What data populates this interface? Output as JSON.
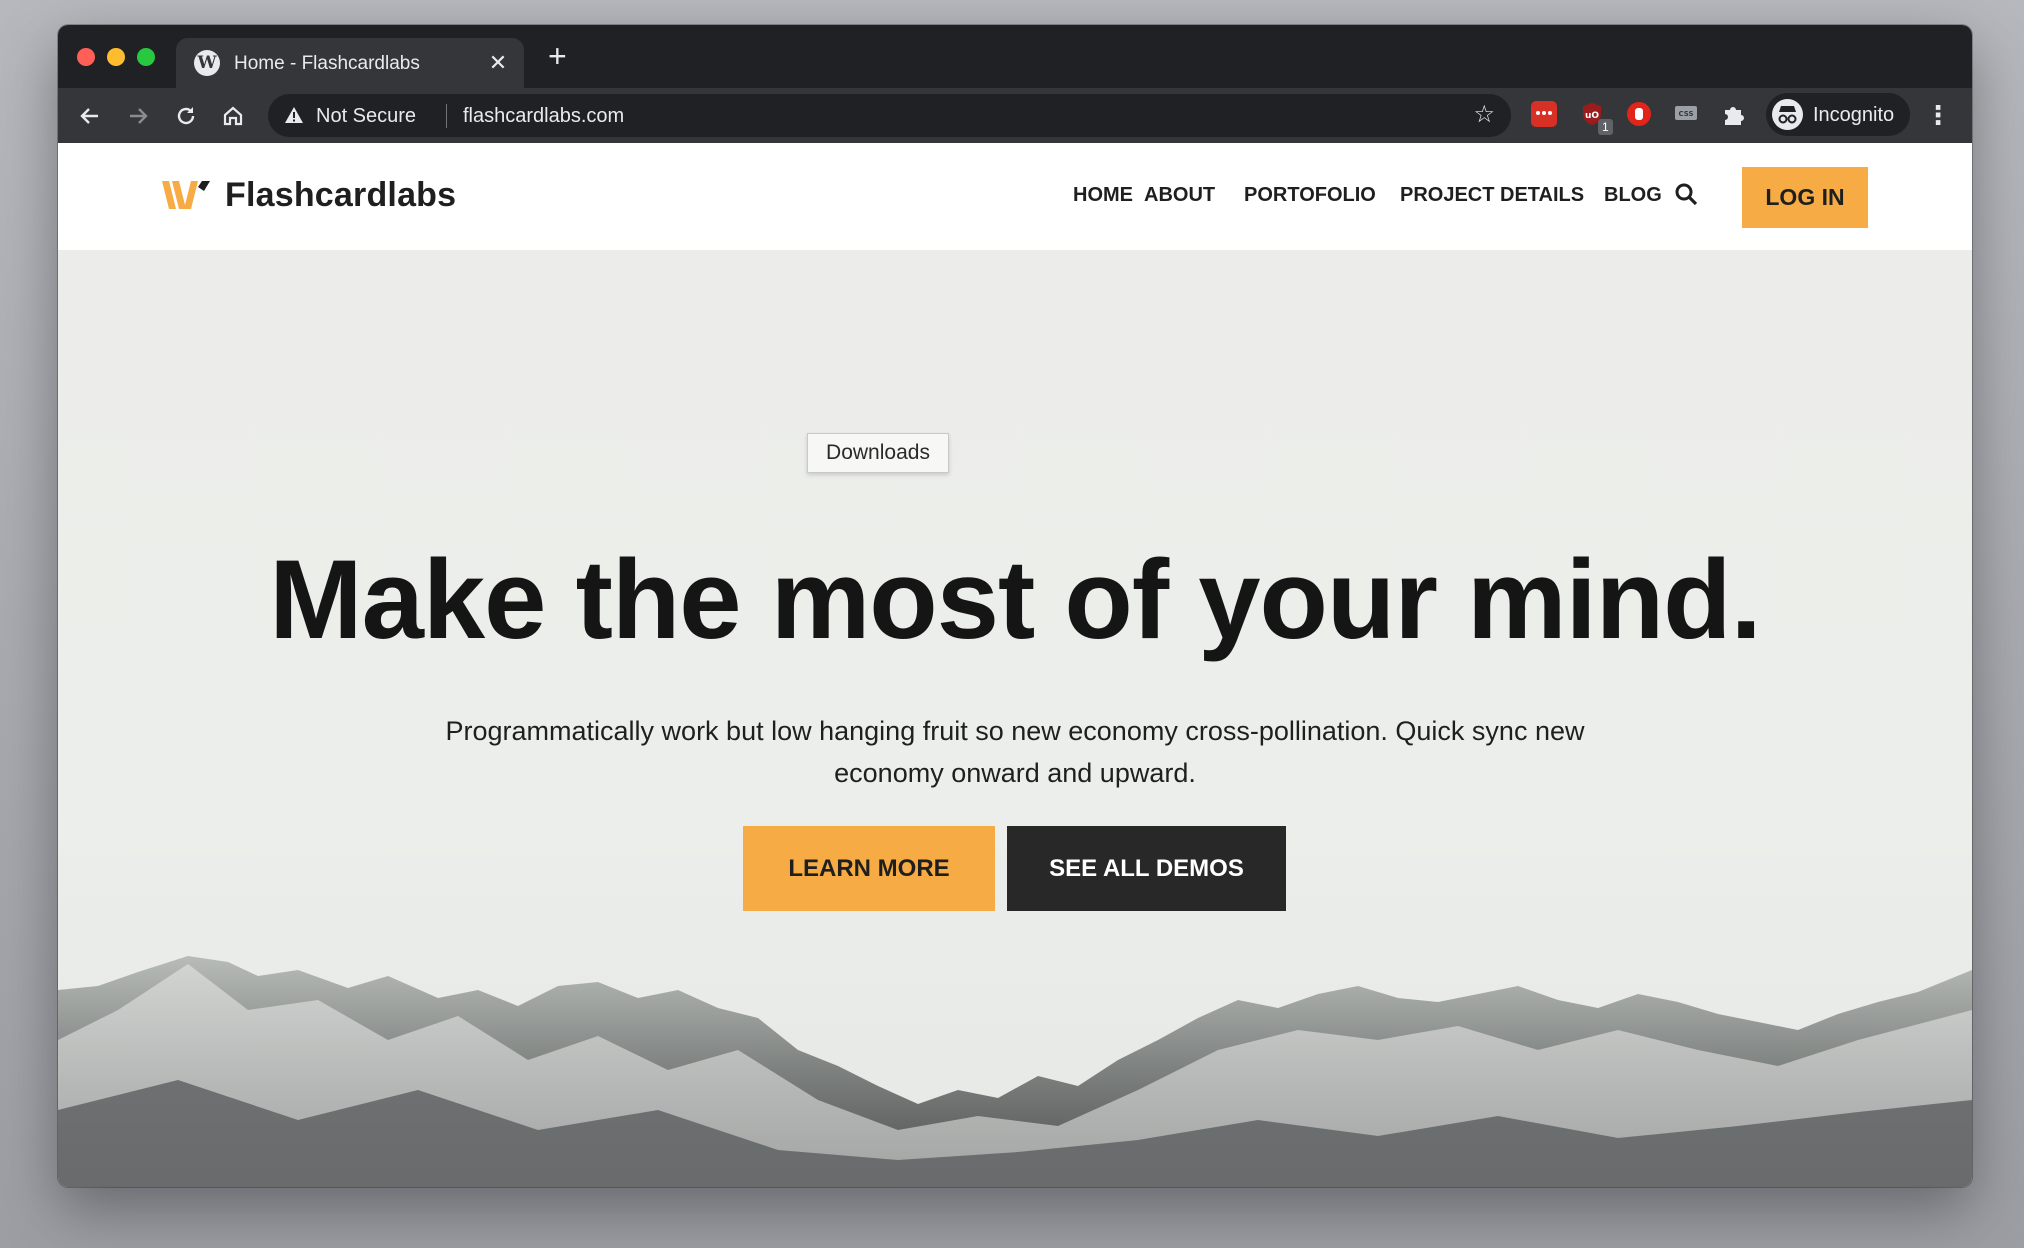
{
  "browser": {
    "tab": {
      "title": "Home - Flashcardlabs",
      "favicon": "wordpress-icon"
    },
    "address": {
      "security_label": "Not Secure",
      "url": "flashcardlabs.com"
    },
    "extensions": [
      {
        "name": "extension-red-icon",
        "badge": "1"
      },
      {
        "name": "ublock-icon"
      },
      {
        "name": "stop-hand-icon"
      },
      {
        "name": "css-extension-icon"
      },
      {
        "name": "puzzle-icon"
      }
    ],
    "profile": {
      "label": "Incognito"
    }
  },
  "site": {
    "brand": {
      "name": "Flashcardlabs",
      "accent": "#f7ab45"
    },
    "nav": [
      {
        "label": "HOME"
      },
      {
        "label": "ABOUT"
      },
      {
        "label": "PORTOFOLIO"
      },
      {
        "label": "PROJECT DETAILS"
      },
      {
        "label": "BLOG"
      }
    ],
    "login_label": "LOG IN"
  },
  "tooltip": {
    "text": "Downloads"
  },
  "hero": {
    "title": "Make the most of your mind.",
    "subtitle": "Programmatically work but low hanging fruit so new economy cross-pollination. Quick sync new economy onward and upward.",
    "primary_button": "LEARN MORE",
    "secondary_button": "SEE ALL DEMOS"
  },
  "colors": {
    "accent": "#f7ab45",
    "dark_button": "#282828",
    "browser_frame": "#202124",
    "toolbar": "#35363a"
  }
}
